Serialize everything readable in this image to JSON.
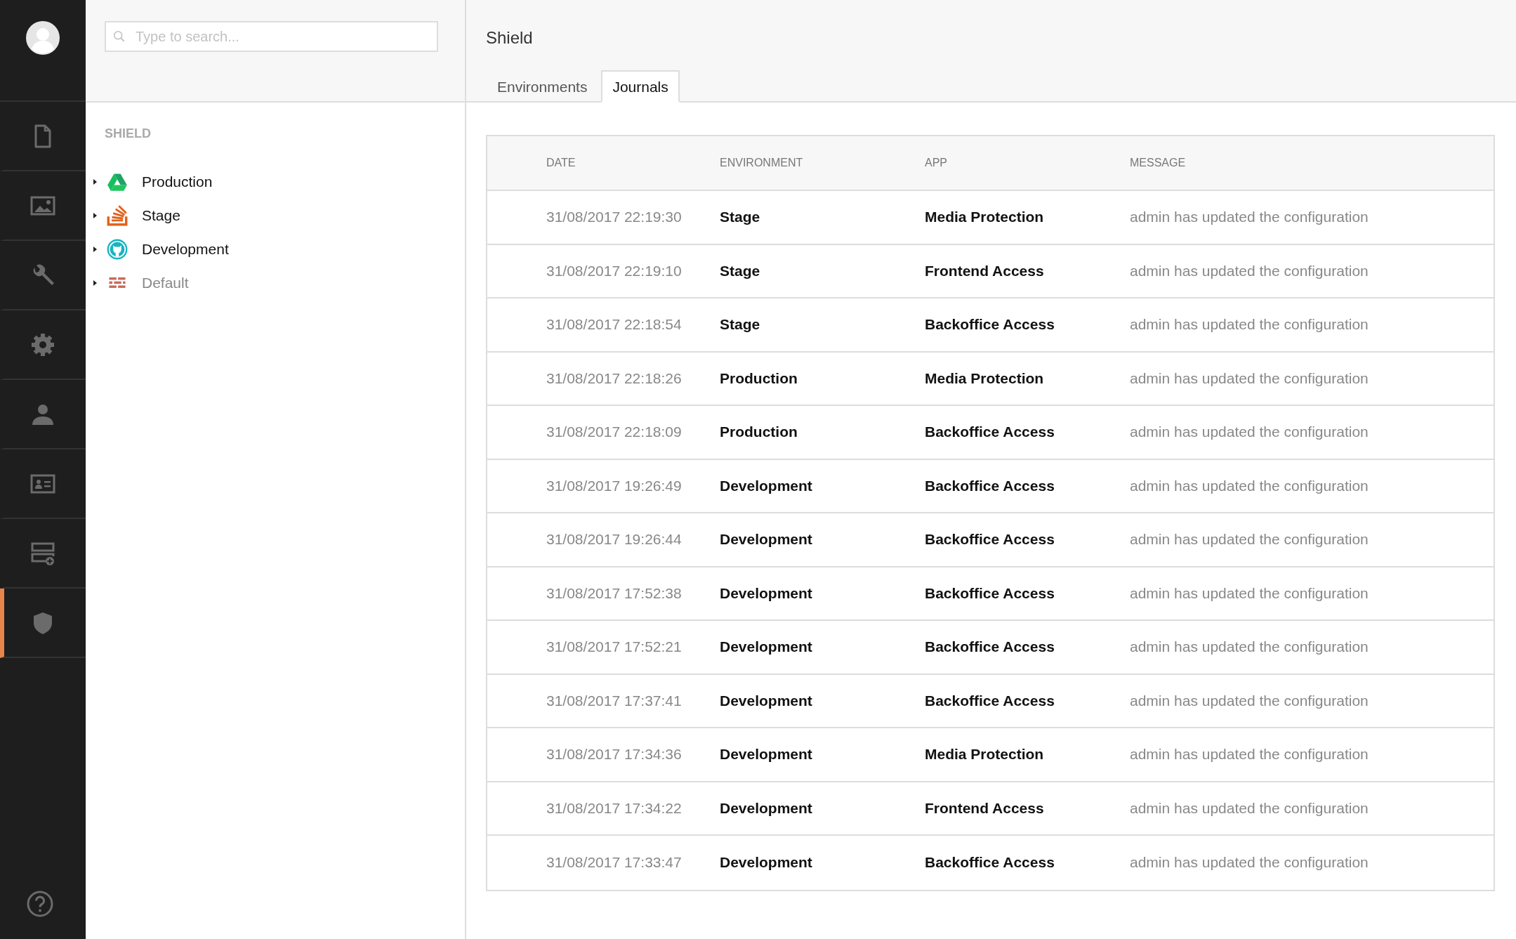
{
  "nav": {
    "items": [
      {
        "kind": "file",
        "selected": false
      },
      {
        "kind": "image",
        "selected": false
      },
      {
        "kind": "wrench",
        "selected": false
      },
      {
        "kind": "gear",
        "selected": false
      },
      {
        "kind": "person",
        "selected": false
      },
      {
        "kind": "idcard",
        "selected": false
      },
      {
        "kind": "addrows",
        "selected": false
      },
      {
        "kind": "shield",
        "selected": true
      }
    ]
  },
  "search": {
    "placeholder": "Type to search..."
  },
  "tree": {
    "heading": "SHIELD",
    "items": [
      {
        "label": "Production",
        "kind": "drive",
        "expanded": false,
        "disabled": false
      },
      {
        "label": "Stage",
        "kind": "stack",
        "expanded": false,
        "disabled": false
      },
      {
        "label": "Development",
        "kind": "github",
        "expanded": false,
        "disabled": false
      },
      {
        "label": "Default",
        "kind": "wall",
        "expanded": false,
        "disabled": true
      }
    ]
  },
  "page": {
    "title": "Shield"
  },
  "tabs": [
    {
      "label": "Environments",
      "selected": false
    },
    {
      "label": "Journals",
      "selected": true
    }
  ],
  "table": {
    "columns": [
      "DATE",
      "ENVIRONMENT",
      "APP",
      "MESSAGE"
    ],
    "rows": [
      [
        "31/08/2017 22:19:30",
        "Stage",
        "Media Protection",
        "admin has updated the configuration"
      ],
      [
        "31/08/2017 22:19:10",
        "Stage",
        "Frontend Access",
        "admin has updated the configuration"
      ],
      [
        "31/08/2017 22:18:54",
        "Stage",
        "Backoffice Access",
        "admin has updated the configuration"
      ],
      [
        "31/08/2017 22:18:26",
        "Production",
        "Media Protection",
        "admin has updated the configuration"
      ],
      [
        "31/08/2017 22:18:09",
        "Production",
        "Backoffice Access",
        "admin has updated the configuration"
      ],
      [
        "31/08/2017 19:26:49",
        "Development",
        "Backoffice Access",
        "admin has updated the configuration"
      ],
      [
        "31/08/2017 19:26:44",
        "Development",
        "Backoffice Access",
        "admin has updated the configuration"
      ],
      [
        "31/08/2017 17:52:38",
        "Development",
        "Backoffice Access",
        "admin has updated the configuration"
      ],
      [
        "31/08/2017 17:52:21",
        "Development",
        "Backoffice Access",
        "admin has updated the configuration"
      ],
      [
        "31/08/2017 17:37:41",
        "Development",
        "Backoffice Access",
        "admin has updated the configuration"
      ],
      [
        "31/08/2017 17:34:36",
        "Development",
        "Media Protection",
        "admin has updated the configuration"
      ],
      [
        "31/08/2017 17:34:22",
        "Development",
        "Frontend Access",
        "admin has updated the configuration"
      ],
      [
        "31/08/2017 17:33:47",
        "Development",
        "Backoffice Access",
        "admin has updated the configuration"
      ]
    ]
  }
}
